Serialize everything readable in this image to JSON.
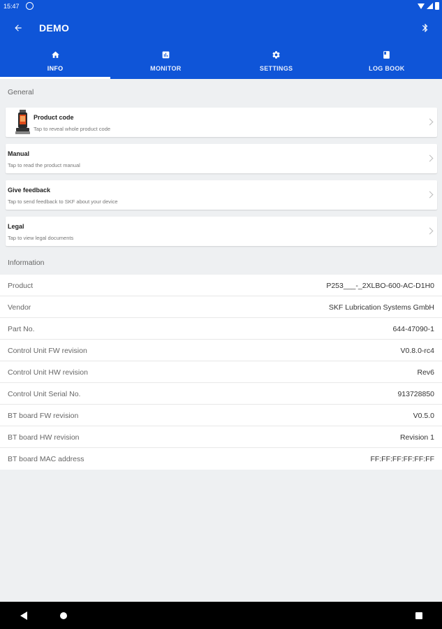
{
  "status_bar": {
    "time": "15:47"
  },
  "toolbar": {
    "title": "DEMO",
    "back_icon": "arrow-left-icon",
    "bluetooth_icon": "bluetooth-icon"
  },
  "tabs": [
    {
      "label": "INFO",
      "icon": "home-icon",
      "active": true
    },
    {
      "label": "MONITOR",
      "icon": "monitor-chart-icon",
      "active": false
    },
    {
      "label": "SETTINGS",
      "icon": "gear-icon",
      "active": false
    },
    {
      "label": "LOG BOOK",
      "icon": "book-icon",
      "active": false
    }
  ],
  "general": {
    "header": "General",
    "items": [
      {
        "title": "Product code",
        "subtitle": "Tap to reveal whole product code"
      },
      {
        "title": "Manual",
        "subtitle": "Tap to read the product manual"
      },
      {
        "title": "Give feedback",
        "subtitle": "Tap to send feedback to SKF about your device"
      },
      {
        "title": "Legal",
        "subtitle": "Tap to view legal documents"
      }
    ]
  },
  "information": {
    "header": "Information",
    "rows": [
      {
        "label": "Product",
        "value": "P253___-_2XLBO-600-AC-D1H0"
      },
      {
        "label": "Vendor",
        "value": "SKF Lubrication Systems GmbH"
      },
      {
        "label": "Part No.",
        "value": "644-47090-1"
      },
      {
        "label": "Control Unit FW revision",
        "value": "V0.8.0-rc4"
      },
      {
        "label": "Control Unit HW revision",
        "value": "Rev6"
      },
      {
        "label": "Control Unit Serial No.",
        "value": "913728850"
      },
      {
        "label": "BT board FW revision",
        "value": "V0.5.0"
      },
      {
        "label": "BT board HW revision",
        "value": "Revision 1"
      },
      {
        "label": "BT board MAC address",
        "value": "FF:FF:FF:FF:FF:FF"
      }
    ]
  },
  "colors": {
    "primary": "#0f55d8",
    "background": "#eef0f2",
    "card": "#ffffff",
    "nav_bar": "#000000"
  }
}
